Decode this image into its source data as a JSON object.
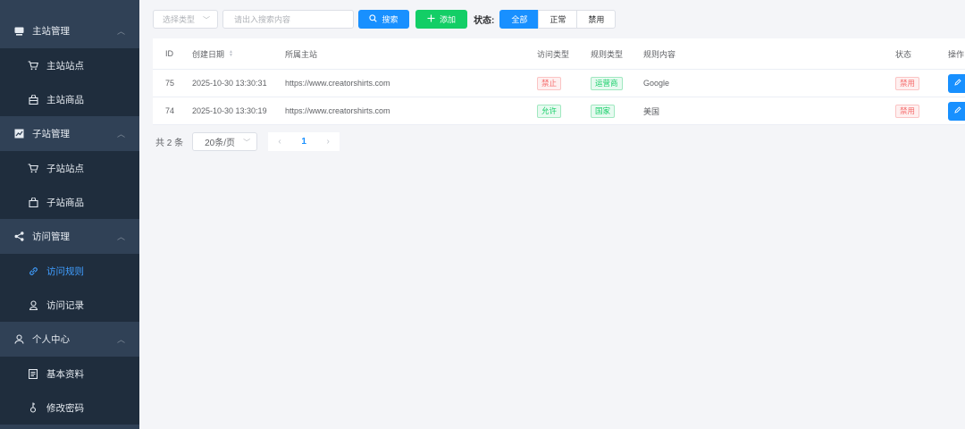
{
  "sidebar": {
    "groups": [
      {
        "label": "主站管理",
        "icon": "monitor-icon",
        "items": [
          {
            "label": "主站站点",
            "icon": "cart-icon"
          },
          {
            "label": "主站商品",
            "icon": "bag-icon"
          }
        ]
      },
      {
        "label": "子站管理",
        "icon": "chart-icon",
        "items": [
          {
            "label": "子站站点",
            "icon": "cart-icon"
          },
          {
            "label": "子站商品",
            "icon": "bag-icon"
          }
        ]
      },
      {
        "label": "访问管理",
        "icon": "share-icon",
        "items": [
          {
            "label": "访问规则",
            "icon": "link-icon",
            "active": true
          },
          {
            "label": "访问记录",
            "icon": "user-record-icon"
          }
        ]
      },
      {
        "label": "个人中心",
        "icon": "user-icon",
        "items": [
          {
            "label": "基本资料",
            "icon": "document-icon"
          },
          {
            "label": "修改密码",
            "icon": "key-icon"
          }
        ]
      }
    ]
  },
  "toolbar": {
    "type_select_placeholder": "选择类型",
    "search_placeholder": "请出入搜索内容",
    "search_label": "搜索",
    "add_label": "添加",
    "status_label": "状态:",
    "status_options": [
      "全部",
      "正常",
      "禁用"
    ],
    "status_selected": "全部"
  },
  "table": {
    "headers": {
      "id": "ID",
      "date": "创建日期",
      "site": "所属主站",
      "access": "访问类型",
      "rule_type": "规则类型",
      "rule_content": "规则内容",
      "status": "状态",
      "op": "操作"
    },
    "rows": [
      {
        "id": "75",
        "date": "2025-10-30 13:30:31",
        "site": "https://www.creatorshirts.com",
        "access": "禁止",
        "access_color": "red",
        "rule_type": "运营商",
        "rule_content": "Google",
        "status": "禁用"
      },
      {
        "id": "74",
        "date": "2025-10-30 13:30:19",
        "site": "https://www.creatorshirts.com",
        "access": "允许",
        "access_color": "green",
        "rule_type": "国家",
        "rule_content": "美国",
        "status": "禁用"
      }
    ]
  },
  "pager": {
    "total": "共 2 条",
    "page_size": "20条/页",
    "current_page": "1"
  },
  "colors": {
    "sidebar_bg": "#304156",
    "sidebar_sub_bg": "#1f2d3d",
    "primary": "#1890ff",
    "success": "#13ce66",
    "danger": "#f56c6c"
  }
}
